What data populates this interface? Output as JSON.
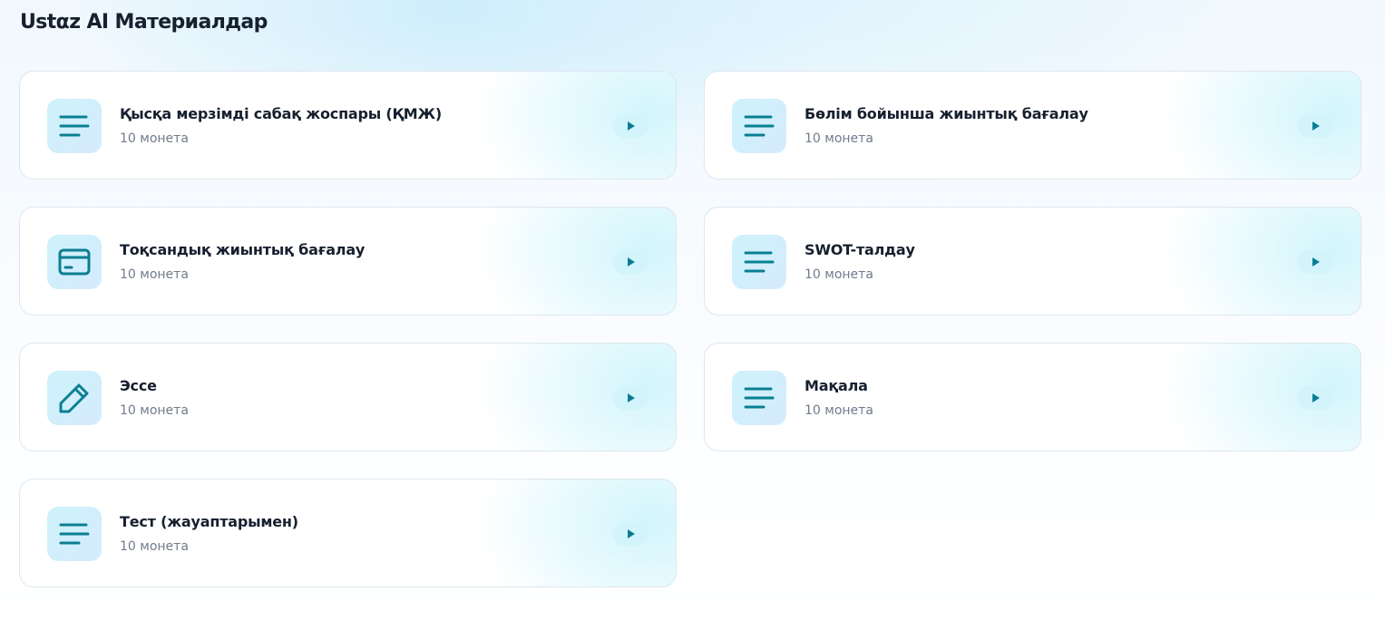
{
  "page": {
    "title": "Ustαz AI Материалдар"
  },
  "colors": {
    "accent": "#0b7f92",
    "icon_tile_bg": "#cdf2fb",
    "play_button_bg": "#d3f4fb",
    "title_text": "#16202e",
    "subtitle_text": "#6f7c8c"
  },
  "materials": [
    {
      "title": "Қысқа мерзімді сабақ жоспары (ҚМЖ)",
      "price": "10 монета",
      "icon": "text-lines-icon"
    },
    {
      "title": "Бөлім бойынша жиынтық бағалау",
      "price": "10 монета",
      "icon": "text-lines-icon"
    },
    {
      "title": "Тоқсандық жиынтық бағалау",
      "price": "10 монета",
      "icon": "card-icon"
    },
    {
      "title": "SWOT-талдау",
      "price": "10 монета",
      "icon": "text-lines-icon"
    },
    {
      "title": "Эссе",
      "price": "10 монета",
      "icon": "pencil-icon"
    },
    {
      "title": "Мақала",
      "price": "10 монета",
      "icon": "text-lines-icon"
    },
    {
      "title": "Тест (жауаптарымен)",
      "price": "10 монета",
      "icon": "text-lines-icon"
    }
  ]
}
